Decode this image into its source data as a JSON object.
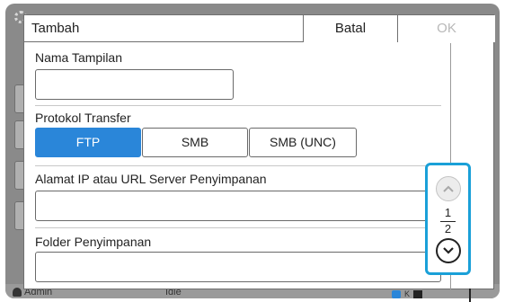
{
  "dialog": {
    "title": "Tambah",
    "cancel_label": "Batal",
    "ok_label": "OK"
  },
  "fields": {
    "display_name": {
      "label": "Nama Tampilan",
      "value": ""
    },
    "protocol": {
      "label": "Protokol Transfer",
      "options": [
        "FTP",
        "SMB",
        "SMB (UNC)"
      ],
      "selected": "FTP"
    },
    "server": {
      "label": "Alamat IP atau URL Server Penyimpanan",
      "value": ""
    },
    "folder": {
      "label": "Folder Penyimpanan",
      "value": ""
    }
  },
  "pager": {
    "current": "1",
    "total": "2",
    "up_icon": "chevron-up-icon",
    "down_icon": "chevron-down-icon"
  },
  "status_bar": {
    "user": "Admin",
    "state": "Idle",
    "toner_label": "K"
  },
  "colors": {
    "accent": "#2a86d9",
    "highlight": "#1aa0d8",
    "disabled_text": "#b8b8b8"
  }
}
